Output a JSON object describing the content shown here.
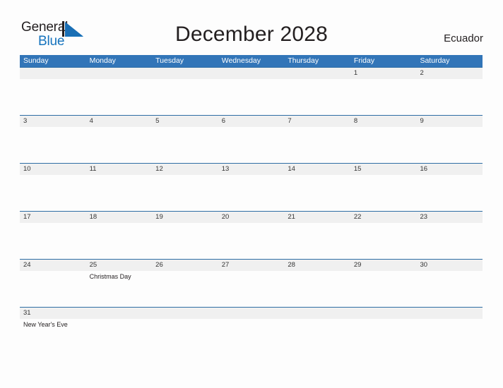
{
  "brand": {
    "name_part1": "General",
    "name_part2": "Blue",
    "flag_icon": "blue-flag-triangle-icon",
    "colors": {
      "text_dark": "#231f20",
      "blue": "#1573bd"
    }
  },
  "header": {
    "title": "December 2028",
    "country": "Ecuador"
  },
  "theme": {
    "header_blue": "#3275b8",
    "row_divider_blue": "#2e6da4",
    "date_band_gray": "#f0f0f0",
    "page_background": "#fdfdfd"
  },
  "calendar": {
    "month": "December",
    "year": "2028",
    "weekday_headers": [
      "Sunday",
      "Monday",
      "Tuesday",
      "Wednesday",
      "Thursday",
      "Friday",
      "Saturday"
    ],
    "weeks": [
      {
        "days": [
          {
            "num": "",
            "event": ""
          },
          {
            "num": "",
            "event": ""
          },
          {
            "num": "",
            "event": ""
          },
          {
            "num": "",
            "event": ""
          },
          {
            "num": "",
            "event": ""
          },
          {
            "num": "1",
            "event": ""
          },
          {
            "num": "2",
            "event": ""
          }
        ]
      },
      {
        "days": [
          {
            "num": "3",
            "event": ""
          },
          {
            "num": "4",
            "event": ""
          },
          {
            "num": "5",
            "event": ""
          },
          {
            "num": "6",
            "event": ""
          },
          {
            "num": "7",
            "event": ""
          },
          {
            "num": "8",
            "event": ""
          },
          {
            "num": "9",
            "event": ""
          }
        ]
      },
      {
        "days": [
          {
            "num": "10",
            "event": ""
          },
          {
            "num": "11",
            "event": ""
          },
          {
            "num": "12",
            "event": ""
          },
          {
            "num": "13",
            "event": ""
          },
          {
            "num": "14",
            "event": ""
          },
          {
            "num": "15",
            "event": ""
          },
          {
            "num": "16",
            "event": ""
          }
        ]
      },
      {
        "days": [
          {
            "num": "17",
            "event": ""
          },
          {
            "num": "18",
            "event": ""
          },
          {
            "num": "19",
            "event": ""
          },
          {
            "num": "20",
            "event": ""
          },
          {
            "num": "21",
            "event": ""
          },
          {
            "num": "22",
            "event": ""
          },
          {
            "num": "23",
            "event": ""
          }
        ]
      },
      {
        "days": [
          {
            "num": "24",
            "event": ""
          },
          {
            "num": "25",
            "event": "Christmas Day"
          },
          {
            "num": "26",
            "event": ""
          },
          {
            "num": "27",
            "event": ""
          },
          {
            "num": "28",
            "event": ""
          },
          {
            "num": "29",
            "event": ""
          },
          {
            "num": "30",
            "event": ""
          }
        ]
      },
      {
        "days": [
          {
            "num": "31",
            "event": "New Year's Eve"
          },
          {
            "num": "",
            "event": ""
          },
          {
            "num": "",
            "event": ""
          },
          {
            "num": "",
            "event": ""
          },
          {
            "num": "",
            "event": ""
          },
          {
            "num": "",
            "event": ""
          },
          {
            "num": "",
            "event": ""
          }
        ]
      }
    ]
  }
}
